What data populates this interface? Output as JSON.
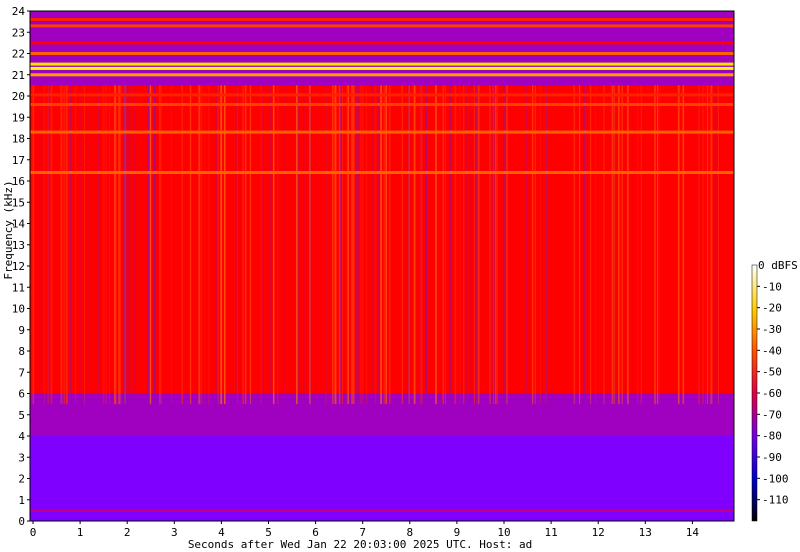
{
  "chart_data": {
    "type": "heatmap",
    "title": "",
    "xlabel": "Seconds after Wed Jan 22 20:03:00 2025 UTC. Host: ad",
    "ylabel": "Frequency (kHz)",
    "xlim": [
      0,
      14.8
    ],
    "ylim": [
      0,
      24
    ],
    "x_ticks": [
      "0",
      "1",
      "2",
      "3",
      "4",
      "5",
      "6",
      "7",
      "8",
      "9",
      "10",
      "11",
      "12",
      "13",
      "14"
    ],
    "y_ticks": [
      "0",
      "1",
      "2",
      "3",
      "4",
      "5",
      "6",
      "7",
      "8",
      "9",
      "10",
      "11",
      "12",
      "13",
      "14",
      "15",
      "16",
      "17",
      "18",
      "19",
      "20",
      "21",
      "22",
      "23",
      "24"
    ],
    "colorbar": {
      "unit_label": "0 dBFS",
      "range": [
        -120,
        0
      ],
      "ticks": [
        "-10",
        "-20",
        "-30",
        "-40",
        "-50",
        "-60",
        "-70",
        "-80",
        "-90",
        "-100",
        "-110"
      ],
      "colormap": [
        "#000000",
        "#0000ff",
        "#8000ff",
        "#ff0000",
        "#ff8000",
        "#ffff00",
        "#ffffff"
      ]
    },
    "bands_khz": [
      {
        "from": 0,
        "to": 4,
        "level_dbfs": -80
      },
      {
        "from": 4,
        "to": 6,
        "level_dbfs": -75
      },
      {
        "from": 6,
        "to": 20.5,
        "level_dbfs": -60
      },
      {
        "from": 20.5,
        "to": 24,
        "level_dbfs": -75
      }
    ],
    "tones_khz": [
      {
        "freq": 23.6,
        "level_dbfs": -55
      },
      {
        "freq": 23.3,
        "level_dbfs": -50
      },
      {
        "freq": 22.5,
        "level_dbfs": -60
      },
      {
        "freq": 22.0,
        "level_dbfs": -45
      },
      {
        "freq": 21.5,
        "level_dbfs": -25
      },
      {
        "freq": 21.3,
        "level_dbfs": -20
      },
      {
        "freq": 21.0,
        "level_dbfs": -35
      },
      {
        "freq": 20.05,
        "level_dbfs": -55
      },
      {
        "freq": 19.6,
        "level_dbfs": -50
      },
      {
        "freq": 18.3,
        "level_dbfs": -45
      },
      {
        "freq": 16.4,
        "level_dbfs": -45
      },
      {
        "freq": 0.5,
        "level_dbfs": -70
      }
    ]
  }
}
